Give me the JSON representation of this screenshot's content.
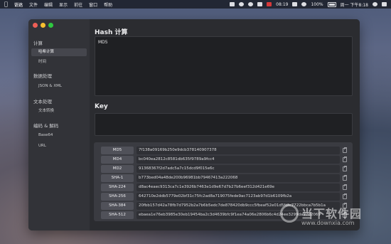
{
  "menubar": {
    "app_name": "访达",
    "items": [
      "文件",
      "编辑",
      "显示",
      "前往",
      "窗口",
      "帮助"
    ],
    "clock": "08:19",
    "battery": "100%",
    "date_time": "周一 下午8:18"
  },
  "sidebar": {
    "groups": [
      {
        "title": "计算",
        "items": [
          "哈希计算",
          "时间"
        ]
      },
      {
        "title": "数据处理",
        "items": [
          "JSON & XML"
        ]
      },
      {
        "title": "文本处理",
        "items": [
          "文本转换"
        ]
      },
      {
        "title": "编码 & 解码",
        "items": [
          "Base64",
          "URL"
        ]
      }
    ],
    "selected": "哈希计算"
  },
  "main": {
    "hash_title": "Hash 计算",
    "input_value": "MD5",
    "key_title": "Key",
    "key_value": "",
    "results": [
      {
        "algo": "MD5",
        "hash": "7f138a09169b250e9dcb378140907378"
      },
      {
        "algo": "MD4",
        "hash": "bc040ea2812c8581db635f9789a9fcc4"
      },
      {
        "algo": "MD2",
        "hash": "91368367f2d7adc5a7c15dcd9f015e6c"
      },
      {
        "algo": "SHA-1",
        "hash": "b773bed04a48de200b96981bb79467413a222068"
      },
      {
        "algo": "SHA-224",
        "hash": "d8ac4eaec9313ca7c1e3926b7463e1d9e67d7b27b6eef312d421e69e"
      },
      {
        "algo": "SHA-256",
        "hash": "642710e2ddb5779e02bf31c75fc2ad8a719075fede9ac7123ab97d1b6109fb2a"
      },
      {
        "algo": "SHA-384",
        "hash": "20fbb157d42a78fb7d7952b2a7b6b5edc7de878420db9ccc5fbeaf52e01d5fdfc7722bbca7b5b1a"
      },
      {
        "algo": "SHA-512",
        "hash": "ebaea1e76eb3985e30eb19454ba2c3d4639bfc9f1ea74a06e2806b6c4d24ee3299da97d2069"
      }
    ]
  },
  "watermark": {
    "brand": "当下软件园",
    "url": "www.downxia.com"
  }
}
